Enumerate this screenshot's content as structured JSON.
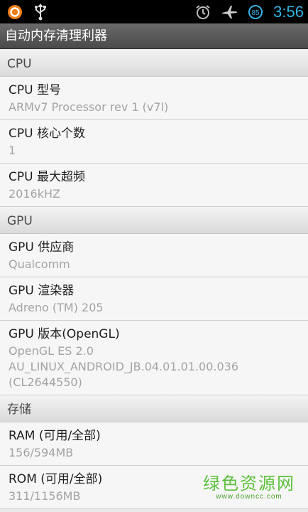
{
  "status_bar": {
    "battery_level": "85",
    "time": "3:56",
    "icons": [
      "app-notification-icon",
      "usb-icon",
      "alarm-icon",
      "airplane-mode-icon",
      "battery-icon"
    ]
  },
  "app": {
    "title": "自动内存清理利器"
  },
  "sections": [
    {
      "title": "CPU",
      "items": [
        {
          "label": "CPU 型号",
          "value": "ARMv7 Processor rev 1 (v7l)"
        },
        {
          "label": "CPU 核心个数",
          "value": "1"
        },
        {
          "label": "CPU 最大超频",
          "value": "2016kHZ"
        }
      ]
    },
    {
      "title": "GPU",
      "items": [
        {
          "label": "GPU 供应商",
          "value": "Qualcomm"
        },
        {
          "label": "GPU 渲染器",
          "value": "Adreno (TM) 205"
        },
        {
          "label": "GPU 版本(OpenGL)",
          "value": "OpenGL ES 2.0\nAU_LINUX_ANDROID_JB.04.01.01.00.036\n(CL2644550)"
        }
      ]
    },
    {
      "title": "存储",
      "items": [
        {
          "label": "RAM (可用/全部)",
          "value": "156/594MB"
        },
        {
          "label": "ROM (可用/全部)",
          "value": "311/1156MB"
        }
      ]
    }
  ],
  "watermark": {
    "text": "绿色资源网",
    "url": "www.downcc.com"
  },
  "colors": {
    "accent": "#33b5e5",
    "watermark": "#5cc13a"
  }
}
